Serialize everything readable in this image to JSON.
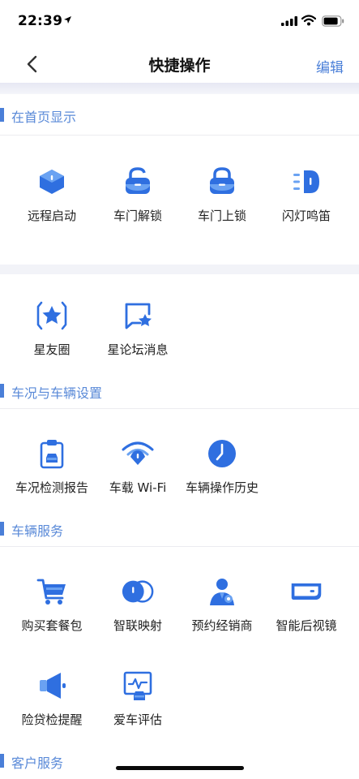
{
  "status_bar": {
    "time": "22:39"
  },
  "nav": {
    "title": "快捷操作",
    "edit_label": "编辑"
  },
  "sections": {
    "home": {
      "title": "在首页显示",
      "items": [
        "远程启动",
        "车门解锁",
        "车门上锁",
        "闪灯鸣笛"
      ]
    },
    "community": {
      "items": [
        "星友圈",
        "星论坛消息"
      ]
    },
    "vehicle_settings": {
      "title": "车况与车辆设置",
      "items": [
        "车况检测报告",
        "车载 Wi-Fi",
        "车辆操作历史"
      ]
    },
    "vehicle_service": {
      "title": "车辆服务",
      "items": [
        "购买套餐包",
        "智联映射",
        "预约经销商",
        "智能后视镜",
        "险贷检提醒",
        "爱车评估"
      ]
    },
    "customer_service": {
      "title": "客户服务"
    }
  },
  "colors": {
    "accent": "#4a7fd8",
    "icon_blue": "#2f6fe0",
    "icon_light": "#6aa2f2"
  }
}
